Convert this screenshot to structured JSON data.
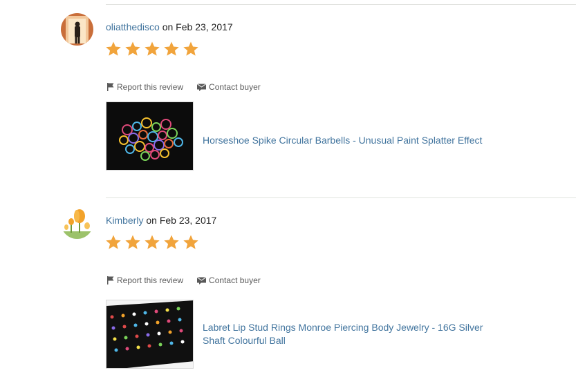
{
  "colors": {
    "link": "#41749e",
    "star": "#f1a43c",
    "muted": "#595959",
    "divider": "#e1e3df"
  },
  "reviews": [
    {
      "username": "oliatthedisco",
      "date_text": " on Feb 23, 2017",
      "rating": 5,
      "report_label": "Report this review",
      "contact_label": "Contact buyer",
      "item_title": "Horseshoe Spike Circular Barbells - Unusual Paint Splatter Effect",
      "avatar_icon": "person-in-doorway-photo",
      "item_image": "colorful-barbell-pile-photo"
    },
    {
      "username": "Kimberly",
      "date_text": " on Feb 23, 2017",
      "rating": 5,
      "report_label": "Report this review",
      "contact_label": "Contact buyer",
      "item_title": "Labret Lip Stud Rings Monroe Piercing Body Jewelry - 16G Silver Shaft Colourful Ball",
      "avatar_icon": "orange-tulips-photo",
      "item_image": "stud-display-tray-photo"
    }
  ]
}
